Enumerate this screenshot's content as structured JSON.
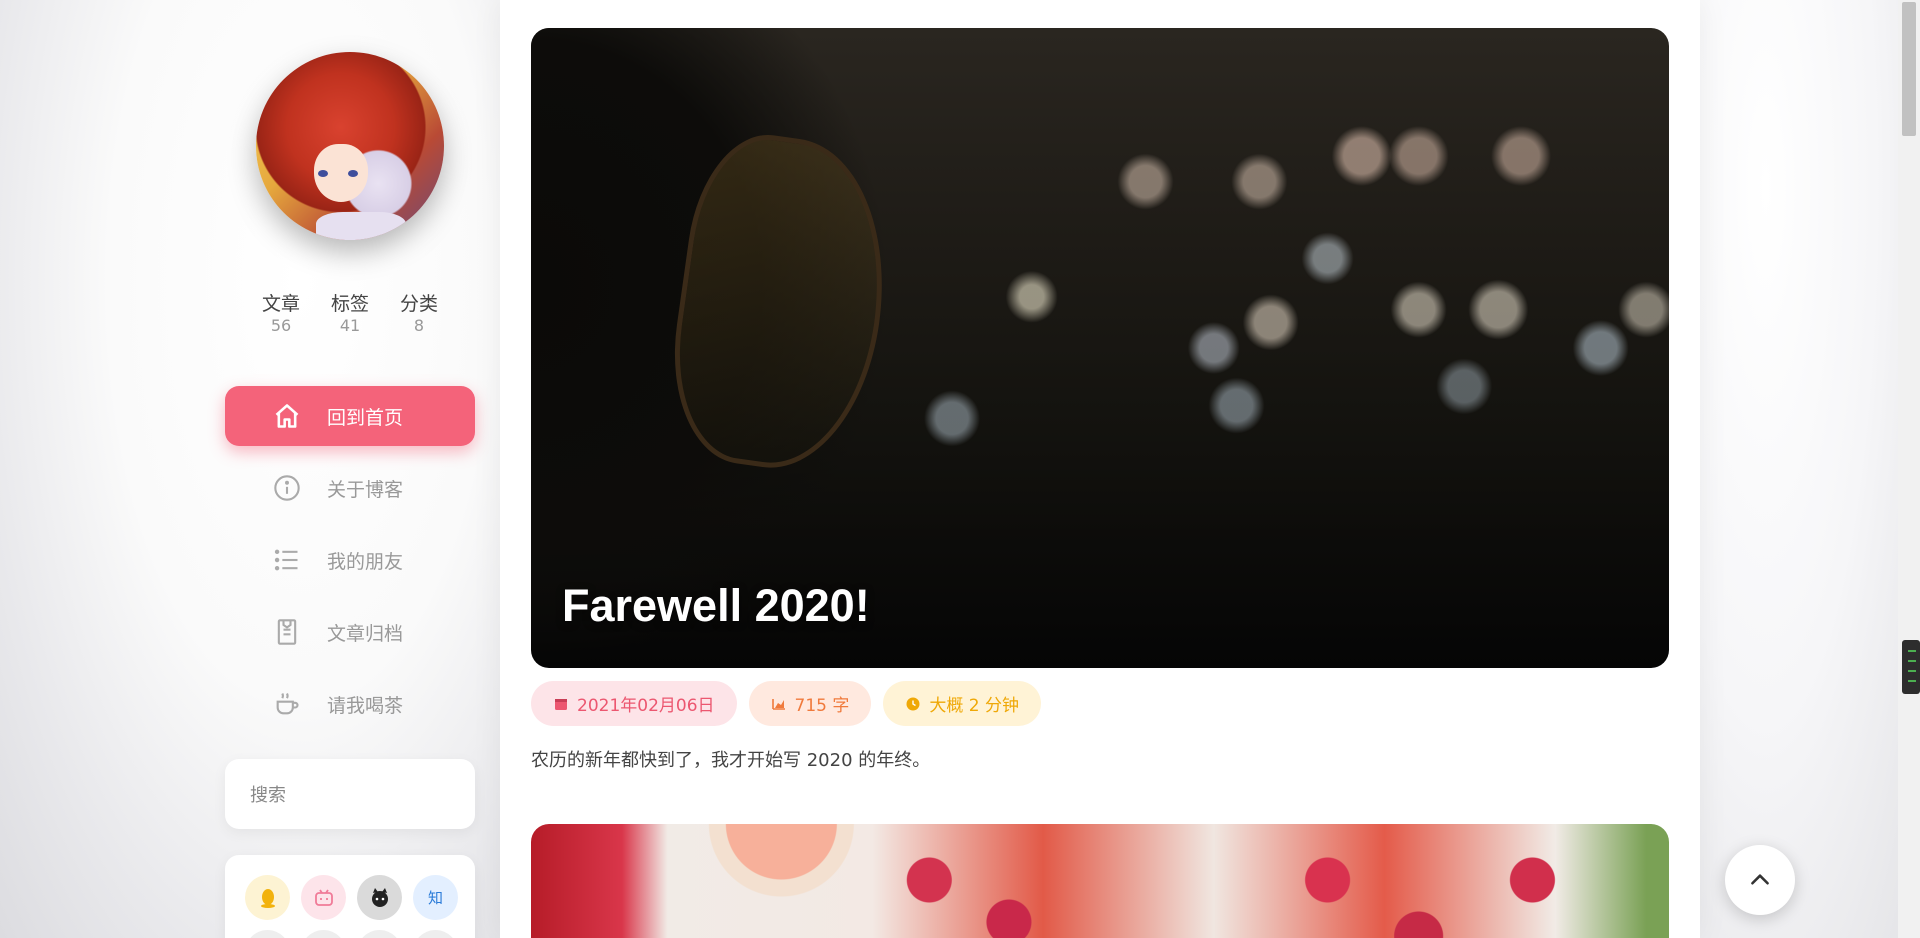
{
  "sidebar": {
    "stats": [
      {
        "label": "文章",
        "value": "56"
      },
      {
        "label": "标签",
        "value": "41"
      },
      {
        "label": "分类",
        "value": "8"
      }
    ],
    "nav": [
      {
        "label": "回到首页",
        "icon": "home-icon",
        "active": true
      },
      {
        "label": "关于博客",
        "icon": "info-icon",
        "active": false
      },
      {
        "label": "我的朋友",
        "icon": "list-icon",
        "active": false
      },
      {
        "label": "文章归档",
        "icon": "archive-icon",
        "active": false
      },
      {
        "label": "请我喝茶",
        "icon": "coffee-icon",
        "active": false
      }
    ],
    "search_placeholder": "搜索",
    "social": [
      {
        "name": "qq-icon",
        "glyph": ""
      },
      {
        "name": "bilibili-icon",
        "glyph": ""
      },
      {
        "name": "github-icon",
        "glyph": ""
      },
      {
        "name": "zhihu-icon",
        "glyph": "知"
      }
    ]
  },
  "post": {
    "title": "Farewell 2020!",
    "date": "2021年02月06日",
    "words": "715 字",
    "read_time": "大概 2 分钟",
    "excerpt": "农历的新年都快到了，我才开始写 2020 的年终。"
  },
  "colors": {
    "accent": "#f4637a",
    "date_pill": "#ec5770",
    "words_pill": "#f07a3c",
    "read_pill": "#efa807"
  }
}
